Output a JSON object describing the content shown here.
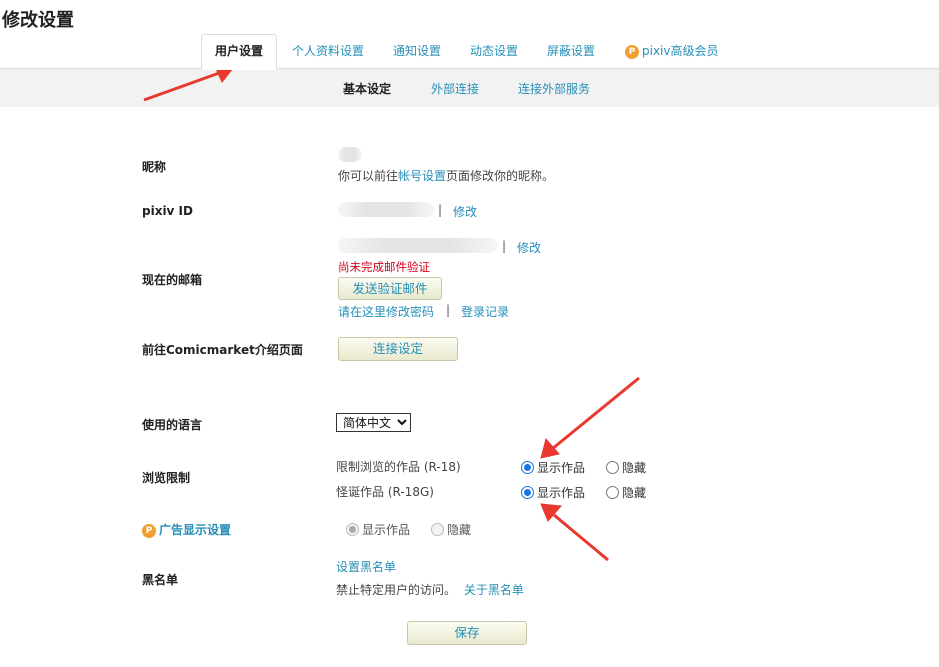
{
  "page": {
    "title": "修改设置"
  },
  "tabs": [
    {
      "label": "用户设置",
      "active": true
    },
    {
      "label": "个人资料设置"
    },
    {
      "label": "通知设置"
    },
    {
      "label": "动态设置"
    },
    {
      "label": "屏蔽设置"
    },
    {
      "label": "pixiv高级会员",
      "icon": "premium-icon"
    }
  ],
  "subtabs": [
    {
      "label": "基本设定",
      "active": true
    },
    {
      "label": "外部连接"
    },
    {
      "label": "连接外部服务"
    }
  ],
  "nickname": {
    "label": "昵称",
    "hint_prefix": "你可以前往",
    "hint_link": "帐号设置",
    "hint_suffix": "页面修改你的昵称。"
  },
  "pixiv_id": {
    "label": "pixiv ID",
    "edit_link": "修改"
  },
  "email": {
    "label": "现在的邮箱",
    "edit_link": "修改",
    "warning": "尚未完成邮件验证",
    "send_button": "发送验证邮件",
    "password_link": "请在这里修改密码",
    "login_history_link": "登录记录"
  },
  "comicmarket": {
    "label": "前往Comicmarket介绍页面",
    "button": "连接设定"
  },
  "language": {
    "label": "使用的语言",
    "selected": "简体中文"
  },
  "browsing": {
    "label": "浏览限制",
    "rows": [
      {
        "name": "限制浏览的作品 (R-18)",
        "show": "显示作品",
        "hide": "隐藏",
        "value": "show"
      },
      {
        "name": "怪诞作品 (R-18G)",
        "show": "显示作品",
        "hide": "隐藏",
        "value": "show"
      }
    ]
  },
  "ads": {
    "label": "广告显示设置",
    "show": "显示作品",
    "hide": "隐藏",
    "value": "show",
    "disabled": true
  },
  "blacklist": {
    "label": "黑名单",
    "set_link": "设置黑名单",
    "desc": "禁止特定用户的访问。",
    "about_link": "关于黑名单"
  },
  "save_button": "保存",
  "colors": {
    "link": "#258fb8",
    "warning": "#d0021b",
    "arrow": "#e8382f",
    "radio": "#1a73e8"
  }
}
